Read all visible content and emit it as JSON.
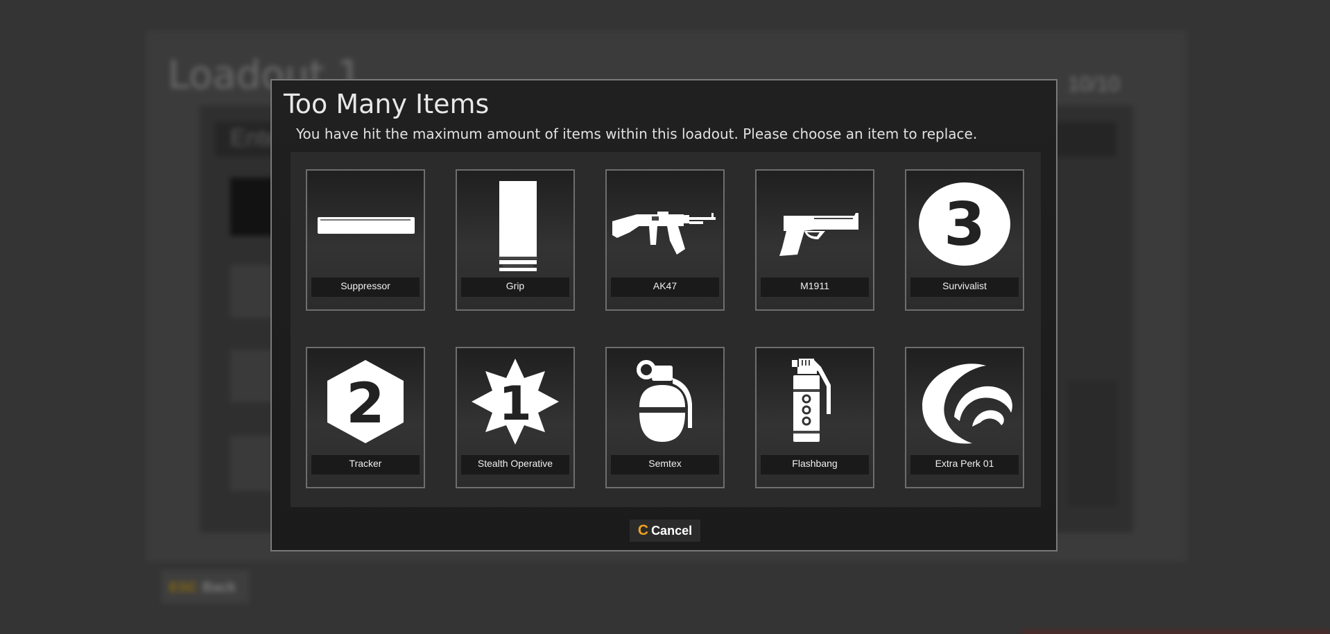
{
  "background": {
    "loadout_title": "Loadout 1",
    "item_count": "10/10",
    "section_heading": "Ente",
    "back_key": "ESC",
    "back_label": "Back"
  },
  "dialog": {
    "title": "Too Many Items",
    "message": "You have hit the maximum amount of items within this loadout. Please choose an item to replace.",
    "items": [
      {
        "label": "Suppressor",
        "icon": "suppressor-icon"
      },
      {
        "label": "Grip",
        "icon": "grip-icon"
      },
      {
        "label": "AK47",
        "icon": "ak47-icon"
      },
      {
        "label": "M1911",
        "icon": "pistol-icon"
      },
      {
        "label": "Survivalist",
        "icon": "perk-3-circle-icon"
      },
      {
        "label": "Tracker",
        "icon": "perk-2-hexagon-icon"
      },
      {
        "label": "Stealth Operative",
        "icon": "perk-1-star-icon"
      },
      {
        "label": "Semtex",
        "icon": "grenade-icon"
      },
      {
        "label": "Flashbang",
        "icon": "flashbang-icon"
      },
      {
        "label": "Extra Perk 01",
        "icon": "crescent-perk-icon"
      }
    ],
    "cancel_key": "C",
    "cancel_label": "Cancel"
  },
  "colors": {
    "accent": "#f0a21c",
    "dialog_border": "#7a7a7a",
    "tile_border": "#6e6e6e",
    "label_background": "#1a1a1a"
  }
}
